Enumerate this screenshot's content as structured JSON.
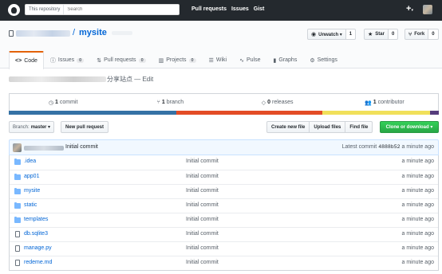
{
  "header": {
    "search_scope": "This repository",
    "search_placeholder": "Search",
    "nav": [
      "Pull requests",
      "Issues",
      "Gist"
    ],
    "plus_icon": "plus-icon",
    "caret": "▾"
  },
  "repo": {
    "separator": "/",
    "name": "mysite",
    "watch": {
      "label": "Unwatch ▾",
      "count": "1",
      "icon": "eye-icon"
    },
    "star": {
      "label": "Star",
      "count": "0",
      "icon": "star-icon"
    },
    "fork": {
      "label": "Fork",
      "count": "0",
      "icon": "fork-icon"
    }
  },
  "tabs": [
    {
      "label": "Code",
      "icon": "code-icon",
      "count": ""
    },
    {
      "label": "Issues",
      "icon": "issue-icon",
      "count": "0"
    },
    {
      "label": "Pull requests",
      "icon": "pull-request-icon",
      "count": "0"
    },
    {
      "label": "Projects",
      "icon": "project-icon",
      "count": "0"
    },
    {
      "label": "Wiki",
      "icon": "wiki-icon",
      "count": ""
    },
    {
      "label": "Pulse",
      "icon": "pulse-icon",
      "count": ""
    },
    {
      "label": "Graphs",
      "icon": "graph-icon",
      "count": ""
    },
    {
      "label": "Settings",
      "icon": "gear-icon",
      "count": ""
    }
  ],
  "description": {
    "text": "分享站点 — Edit"
  },
  "summary": {
    "commits": {
      "num": "1",
      "label": "commit"
    },
    "branches": {
      "num": "1",
      "label": "branch"
    },
    "releases": {
      "num": "0",
      "label": "releases"
    },
    "contributors": {
      "num": "1",
      "label": "contributor"
    }
  },
  "language_bar": [
    {
      "color": "#3572A5",
      "fraction": 0.39
    },
    {
      "color": "#e34c26",
      "fraction": 0.34
    },
    {
      "color": "#f1e05a",
      "fraction": 0.25
    },
    {
      "color": "#563d7c",
      "fraction": 0.02
    }
  ],
  "file_nav": {
    "branch_prefix": "Branch:",
    "branch_name": "master ▾",
    "new_pr": "New pull request",
    "create_file": "Create new file",
    "upload_files": "Upload files",
    "find_file": "Find file",
    "clone": "Clone or download ▾"
  },
  "latest_commit": {
    "message": "Initial commit",
    "label": "Latest commit",
    "sha": "4888b52",
    "age": "a minute ago"
  },
  "files": [
    {
      "name": ".idea",
      "type": "dir",
      "message": "Initial commit",
      "age": "a minute ago"
    },
    {
      "name": "app01",
      "type": "dir",
      "message": "Initial commit",
      "age": "a minute ago"
    },
    {
      "name": "mysite",
      "type": "dir",
      "message": "Initial commit",
      "age": "a minute ago"
    },
    {
      "name": "static",
      "type": "dir",
      "message": "Initial commit",
      "age": "a minute ago"
    },
    {
      "name": "templates",
      "type": "dir",
      "message": "Initial commit",
      "age": "a minute ago"
    },
    {
      "name": "db.sqlite3",
      "type": "file",
      "message": "Initial commit",
      "age": "a minute ago"
    },
    {
      "name": "manage.py",
      "type": "file",
      "message": "Initial commit",
      "age": "a minute ago"
    },
    {
      "name": "redeme.md",
      "type": "file",
      "message": "Initial commit",
      "age": "a minute ago"
    }
  ]
}
